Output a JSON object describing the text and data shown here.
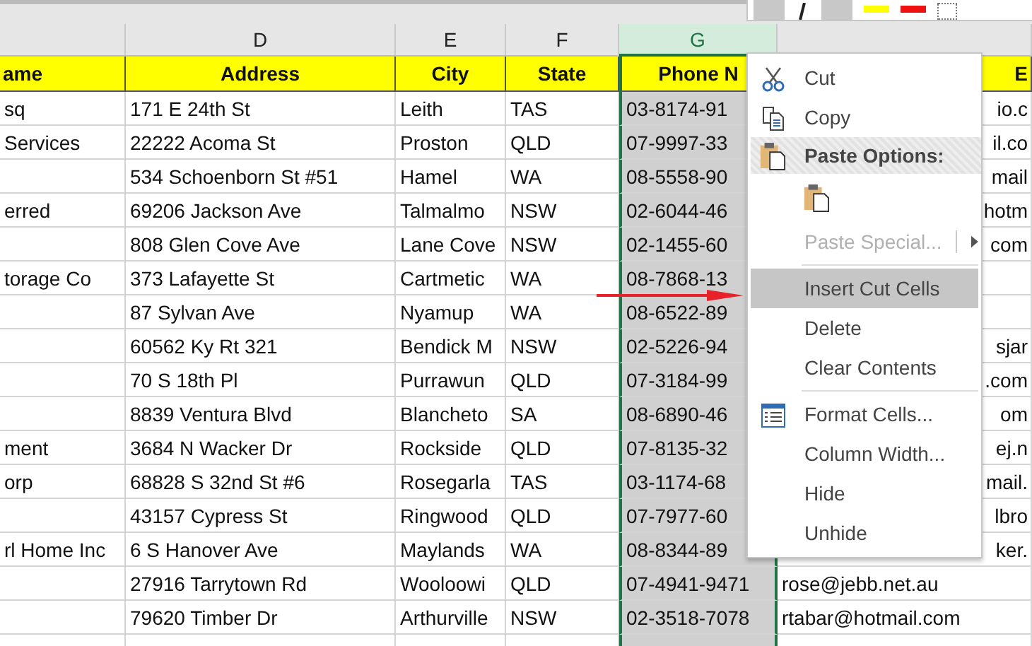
{
  "columns": [
    {
      "selected": false
    },
    {
      "letter": "D",
      "selected": false
    },
    {
      "letter": "E",
      "selected": false
    },
    {
      "letter": "F",
      "selected": false
    },
    {
      "letter": "G",
      "selected": true
    },
    {
      "selected": false
    }
  ],
  "header_row": [
    "ame",
    "Address",
    "City",
    "State",
    "Phone N",
    "E"
  ],
  "rows": [
    {
      "column_c": "sq",
      "address": "171 E 24th St",
      "city": "Leith",
      "state": "TAS",
      "phone_no": "03-8174-91",
      "column_h": "io.c"
    },
    {
      "column_c": "Services",
      "address": "22222 Acoma St",
      "city": "Proston",
      "state": "QLD",
      "phone_no": "07-9997-33",
      "column_h": "il.co"
    },
    {
      "address": "534 Schoenborn St #51",
      "city": "Hamel",
      "state": "WA",
      "phone_no": "08-5558-90",
      "column_h": "mail"
    },
    {
      "column_c": "erred",
      "address": "69206 Jackson Ave",
      "city": "Talmalmo",
      "state": "NSW",
      "phone_no": "02-6044-46",
      "column_h": "hotm"
    },
    {
      "address": "808 Glen Cove Ave",
      "city": "Lane Cove",
      "state": "NSW",
      "phone_no": "02-1455-60",
      "column_h": "com"
    },
    {
      "column_c": "torage Co",
      "address": "373 Lafayette St",
      "city": "Cartmetic",
      "state": "WA",
      "phone_no": "08-7868-13"
    },
    {
      "address": "87 Sylvan Ave",
      "city": "Nyamup",
      "state": "WA",
      "phone_no": "08-6522-89"
    },
    {
      "address": "60562 Ky Rt 321",
      "city": "Bendick M",
      "state": "NSW",
      "phone_no": "02-5226-94",
      "column_h": "sjar"
    },
    {
      "address": "70 S 18th Pl",
      "city": "Purrawun",
      "state": "QLD",
      "phone_no": "07-3184-99",
      "column_h": ".com"
    },
    {
      "address": "8839 Ventura Blvd",
      "city": "Blancheto",
      "state": "SA",
      "phone_no": "08-6890-46",
      "column_h": "om"
    },
    {
      "column_c": "ment",
      "address": "3684 N Wacker Dr",
      "city": "Rockside",
      "state": "QLD",
      "phone_no": "07-8135-32",
      "column_h": "ej.n"
    },
    {
      "column_c": "orp",
      "address": "68828 S 32nd St #6",
      "city": "Rosegarla",
      "state": "TAS",
      "phone_no": "03-1174-68",
      "column_h": "mail."
    },
    {
      "address": "43157 Cypress St",
      "city": "Ringwood",
      "state": "QLD",
      "phone_no": "07-7977-60",
      "column_h": "lbro"
    },
    {
      "column_c": "rl Home Inc",
      "address": "6 S Hanover Ave",
      "city": "Maylands",
      "state": "WA",
      "phone_no": "08-8344-89",
      "column_h": "ker."
    },
    {
      "address": "27916 Tarrytown Rd",
      "city": "Wooloowi",
      "state": "QLD",
      "phone_no": "07-4941-9471",
      "column_h": "rose@jebb.net.au"
    },
    {
      "address": "79620 Timber Dr",
      "city": "Arthurville",
      "state": "NSW",
      "phone_no": "02-3518-7078",
      "column_h": "rtabar@hotmail.com"
    }
  ],
  "context_menu": [
    {
      "kind": "item",
      "label": "Cut",
      "selected": false,
      "disabled": false
    },
    {
      "kind": "item",
      "label": "Copy",
      "selected": false,
      "disabled": false
    },
    {
      "kind": "header",
      "label": "Paste Options:"
    },
    {
      "kind": "paste_icons"
    },
    {
      "kind": "item",
      "label": "Paste Special...",
      "selected": false,
      "disabled": true,
      "submenu": true
    },
    {
      "kind": "separator"
    },
    {
      "kind": "item",
      "label": "Insert Cut Cells",
      "selected": true,
      "disabled": false
    },
    {
      "kind": "item",
      "label": "Delete",
      "selected": false,
      "disabled": false
    },
    {
      "kind": "item",
      "label": "Clear Contents",
      "selected": false,
      "disabled": false
    },
    {
      "kind": "separator"
    },
    {
      "kind": "item",
      "label": "Format Cells...",
      "selected": false,
      "disabled": false
    },
    {
      "kind": "item",
      "label": "Column Width...",
      "selected": false,
      "disabled": false
    },
    {
      "kind": "item",
      "label": "Hide",
      "selected": false,
      "disabled": false
    },
    {
      "kind": "item",
      "label": "Unhide",
      "selected": false,
      "disabled": false
    }
  ]
}
